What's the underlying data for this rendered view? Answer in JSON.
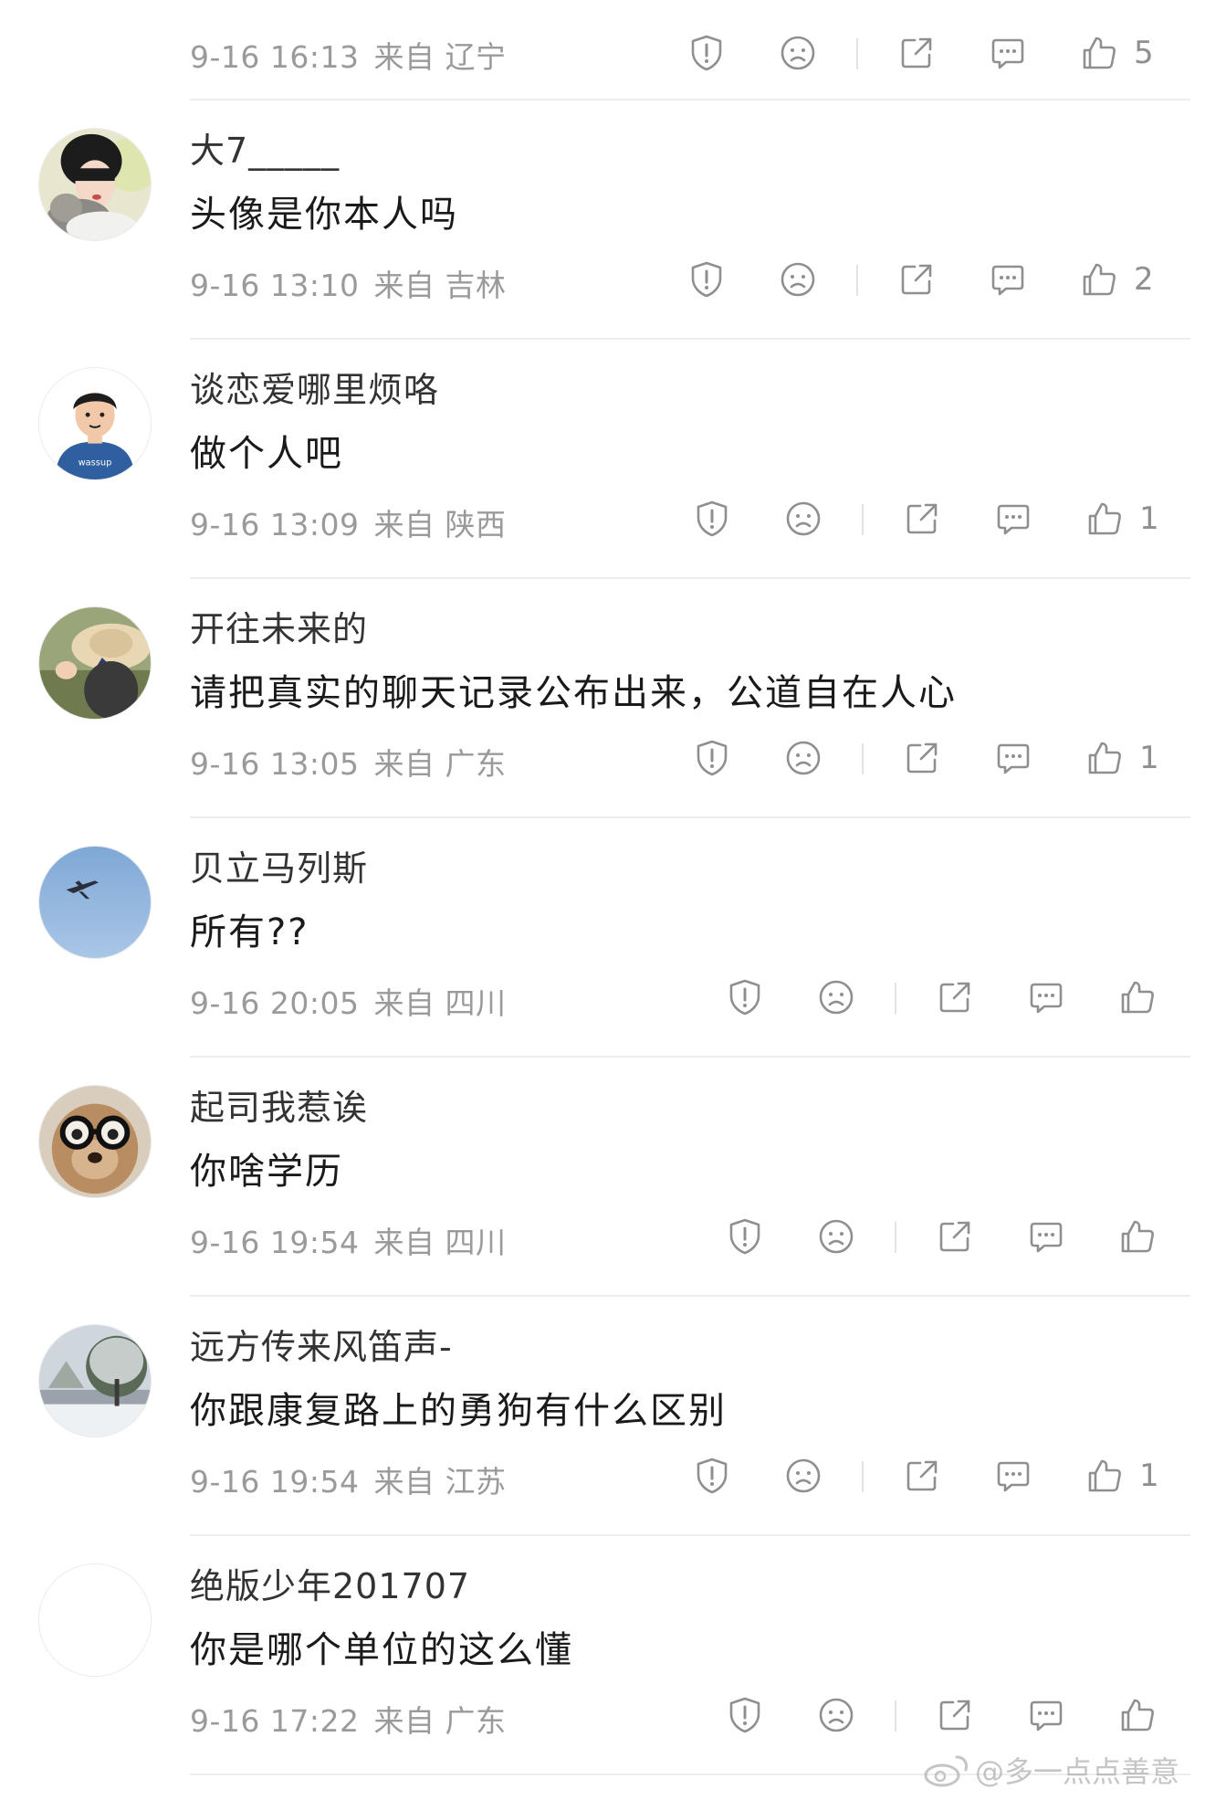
{
  "comments": [
    {
      "username": "",
      "content": "",
      "time": "9-16 16:13",
      "location": "来自 辽宁",
      "likes": "5"
    },
    {
      "username": "大7_____",
      "content": "头像是你本人吗",
      "time": "9-16 13:10",
      "location": "来自 吉林",
      "likes": "2",
      "avatar": "woman-with-cat-avatar"
    },
    {
      "username": "谈恋爱哪里烦咯",
      "content": "做个人吧",
      "time": "9-16 13:09",
      "location": "来自 陕西",
      "likes": "1",
      "avatar": "cartoon-boy-wassup-avatar"
    },
    {
      "username": "开往未来的",
      "content": "请把真实的聊天记录公布出来，公道自在人心",
      "time": "9-16 13:05",
      "location": "来自 广东",
      "likes": "1",
      "avatar": "straw-hat-girl-avatar"
    },
    {
      "username": "贝立马列斯",
      "content": "所有??",
      "time": "9-16 20:05",
      "location": "来自 四川",
      "likes": "",
      "avatar": "airplane-sky-avatar"
    },
    {
      "username": "起司我惹诶",
      "content": "你啥学历",
      "time": "9-16 19:54",
      "location": "来自 四川",
      "likes": "",
      "avatar": "dog-glasses-avatar"
    },
    {
      "username": "远方传来风笛声-",
      "content": "你跟康复路上的勇狗有什么区别",
      "time": "9-16 19:54",
      "location": "来自 江苏",
      "likes": "1",
      "avatar": "snow-tree-avatar"
    },
    {
      "username": "绝版少年201707",
      "content": "你是哪个单位的这么懂",
      "time": "9-16 17:22",
      "location": "来自 广东",
      "likes": "",
      "avatar": "blank-avatar"
    }
  ],
  "icons": {
    "report": "report-shield-icon",
    "dislike": "frown-face-icon",
    "share": "share-icon",
    "reply": "reply-bubble-icon",
    "like": "thumbs-up-icon"
  },
  "colors": {
    "text_primary": "#1a1a1a",
    "text_secondary": "#9a9a9a",
    "icon": "#8f8f8f",
    "divider": "#ededed"
  },
  "watermark": {
    "text": "@多一点点善意"
  }
}
